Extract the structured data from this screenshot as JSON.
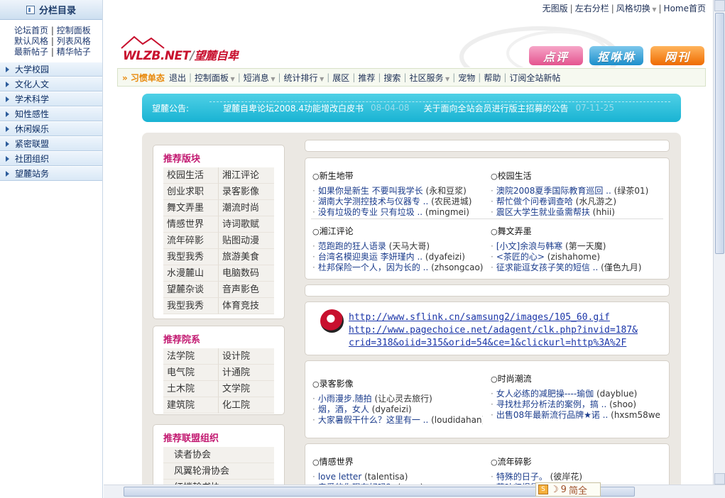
{
  "left": {
    "title": "分栏目录",
    "links": [
      "论坛首页",
      "控制面板",
      "默认风格",
      "列表风格",
      "最新帖子",
      "精华帖子"
    ],
    "items": [
      "大学校园",
      "文化人文",
      "学术科学",
      "知性感性",
      "休闲娱乐",
      "紧密联盟",
      "社团组织",
      "望麓站务"
    ]
  },
  "top": {
    "links": [
      "无图版",
      "左右分栏",
      "风格切换",
      "Home首页"
    ]
  },
  "logo": {
    "en": "WLZB.NET",
    "cn": "望麓自卑"
  },
  "buttons": {
    "review": "点评",
    "chat": "抠咻咻",
    "mag": "网刊"
  },
  "nav": {
    "user": "» 习惯单态",
    "items": [
      "退出",
      "控制面板",
      "短消息",
      "统计排行",
      "展区",
      "推荐",
      "搜索",
      "社区服务",
      "宠物",
      "帮助",
      "订阅全站新帖"
    ]
  },
  "notice": {
    "label": "望麓公告:",
    "items": [
      {
        "text": "望麓自卑论坛2008.4功能增改白皮书",
        "date": "08-04-08"
      },
      {
        "text": "关于面向全站会员进行版主招募的公告",
        "date": "07-11-25"
      }
    ]
  },
  "sidebar": {
    "recommend_boards": {
      "title": "推荐版块",
      "items": [
        "校园生活",
        "湘江评论",
        "创业求职",
        "录客影像",
        "舞文弄墨",
        "潮流时尚",
        "情感世界",
        "诗词歌赋",
        "流年碎影",
        "贴图动漫",
        "我型我秀",
        "旅游美食",
        "水漫麓山",
        "电脑数码",
        "望麓杂谈",
        "音声影色",
        "我型我秀",
        "体育竞技"
      ]
    },
    "recommend_colleges": {
      "title": "推荐院系",
      "items": [
        "法学院",
        "设计院",
        "电气院",
        "计通院",
        "土木院",
        "文学院",
        "建筑院",
        "化工院"
      ]
    },
    "recommend_orgs": {
      "title": "推荐联盟组织",
      "items": [
        "读者协会",
        "风翼轮滑协会",
        "红楼翰书协"
      ]
    }
  },
  "sections": {
    "newborn": {
      "title": "新生地带",
      "posts": [
        {
          "t": "如果你是新生 不要叫我学长",
          "a": "(永和豆浆)"
        },
        {
          "t": "湖南大学测控技术与仪器专 ..",
          "a": "(农民进城)"
        },
        {
          "t": "没有垃圾的专业 只有垃圾 ..",
          "a": "(mingmei)"
        }
      ]
    },
    "campus": {
      "title": "校园生活",
      "posts": [
        {
          "t": "澳院2008夏季国际教育巡回 ..",
          "a": "(绿茶01)"
        },
        {
          "t": "帮忙做个问卷调查哈",
          "a": "(水凡游之)"
        },
        {
          "t": "震区大学生就业亟需帮扶",
          "a": "(hhii)"
        }
      ]
    },
    "xiangjiang": {
      "title": "湘江评论",
      "posts": [
        {
          "t": "范跑跑的狂人语录",
          "a": "(天马大哥)"
        },
        {
          "t": "台湾名模迎奥运 李妍瑾内 ..",
          "a": "(dyafeizi)"
        },
        {
          "t": "杜邦保险一个人，因为长的 ..",
          "a": "(zhsongcao)"
        }
      ]
    },
    "writing": {
      "title": "舞文弄墨",
      "posts": [
        {
          "t": "[小文]余浪与韩寒",
          "a": "(第一天魔)"
        },
        {
          "t": "<茶匠的心>",
          "a": "(zishahome)"
        },
        {
          "t": "征求能逗女孩子笑的短信 ..",
          "a": "(僅色九月)"
        }
      ]
    },
    "photo": {
      "title": "录客影像",
      "posts": [
        {
          "t": "小雨漫步.随拍",
          "a": "(让心灵去旅行)"
        },
        {
          "t": "烟，酒，女人",
          "a": "(dyafeizi)"
        },
        {
          "t": "大家暑假干什么？这里有一 ..",
          "a": "(loudidahan)"
        }
      ]
    },
    "fashion": {
      "title": "时尚潮流",
      "posts": [
        {
          "t": "女人必练的减肥操----瑜伽",
          "a": "(dayblue)"
        },
        {
          "t": "寻找杜邦分析法的案例，搞 ..",
          "a": "(shoo)"
        },
        {
          "t": "出售08年最新流行品牌★诺 ..",
          "a": "(hxsm58web)"
        }
      ]
    },
    "emotion": {
      "title": "情感世界",
      "posts": [
        {
          "t": "love letter",
          "a": "(talentisa)"
        },
        {
          "t": "亲爱的你现在好吗？",
          "a": "(suzy)"
        }
      ]
    },
    "years": {
      "title": "流年碎影",
      "posts": [
        {
          "t": "特殊的日子。",
          "a": "(彼岸花)"
        },
        {
          "t": "落叶归根是回忆 ..",
          "a": "(地山)"
        }
      ]
    }
  },
  "ad": {
    "line1": "http://www.sflink.cn/samsung2/images/105_60.gif",
    "line2": "http://www.pagechoice.net/adagent/clk.php?invid=187&",
    "line3": "crid=318&oiid=315&orid=54&ce=1&clickurl=http%3A%2F"
  },
  "ime": {
    "label": "简全",
    "mode": "9"
  },
  "colors": {
    "accent": "#19b3d3",
    "nav_user": "#e8890c",
    "board_title": "#c21870"
  }
}
